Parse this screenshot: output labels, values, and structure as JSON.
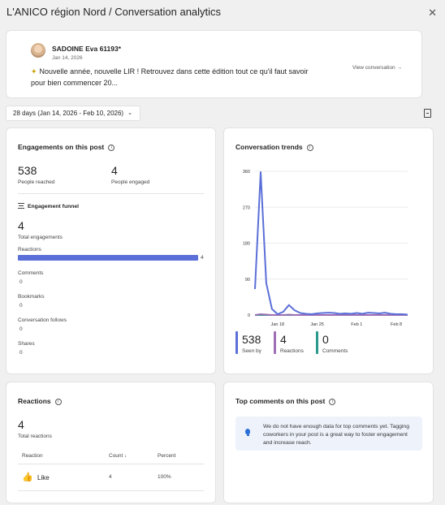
{
  "header": {
    "title": "L'ANICO région Nord / Conversation analytics",
    "close_label": "✕"
  },
  "post": {
    "author": "SADOINE Eva 61193*",
    "date": "Jan 14, 2026",
    "text_line1": "Nouvelle année, nouvelle LIR ! Retrouvez dans cette édition tout ce qu'il faut savoir",
    "text_line2": "pour bien commencer 20...",
    "view_label": "View conversation →"
  },
  "filter": {
    "date_range": "28 days (Jan 14, 2026 - Feb 10, 2026)"
  },
  "engagements": {
    "title": "Engagements on this post",
    "reached_value": "538",
    "reached_label": "People reached",
    "engaged_value": "4",
    "engaged_label": "People engaged",
    "funnel_title": "Engagement funnel",
    "total_value": "4",
    "total_label": "Total engagements",
    "funnel": [
      {
        "label": "Reactions",
        "value": "4",
        "fraction": 1.0
      },
      {
        "label": "Comments",
        "value": "0"
      },
      {
        "label": "Bookmarks",
        "value": "0"
      },
      {
        "label": "Conversation follows",
        "value": "0"
      },
      {
        "label": "Shares",
        "value": "0"
      }
    ]
  },
  "trends": {
    "title": "Conversation trends",
    "legend": [
      {
        "value": "538",
        "label": "Seen by",
        "color": "#5b6fd8"
      },
      {
        "value": "4",
        "label": "Reactions",
        "color": "#9d6fb5"
      },
      {
        "value": "0",
        "label": "Comments",
        "color": "#2a9a8a"
      }
    ]
  },
  "chart_data": {
    "type": "line",
    "title": "Conversation trends",
    "x": [
      "Jan 14",
      "Jan 15",
      "Jan 16",
      "Jan 17",
      "Jan 18",
      "Jan 19",
      "Jan 20",
      "Jan 21",
      "Jan 22",
      "Jan 23",
      "Jan 24",
      "Jan 25",
      "Jan 26",
      "Jan 27",
      "Jan 28",
      "Jan 29",
      "Jan 30",
      "Jan 31",
      "Feb 1",
      "Feb 2",
      "Feb 3",
      "Feb 4",
      "Feb 5",
      "Feb 6",
      "Feb 7",
      "Feb 8",
      "Feb 9",
      "Feb 10"
    ],
    "x_tick_labels": [
      "Jan 18",
      "Jan 25",
      "Feb 1",
      "Feb 8"
    ],
    "y_ticks": [
      "360",
      "270",
      "180",
      "90",
      "0"
    ],
    "ylim": [
      0,
      360
    ],
    "series": [
      {
        "name": "Seen by",
        "color": "#5b6fd8",
        "values": [
          65,
          358,
          80,
          15,
          2,
          8,
          25,
          12,
          5,
          3,
          2,
          4,
          5,
          6,
          5,
          3,
          4,
          3,
          5,
          3,
          6,
          5,
          4,
          6,
          3,
          2,
          2,
          1
        ]
      },
      {
        "name": "Reactions",
        "color": "#9d6fb5",
        "values": [
          0,
          2,
          1,
          0,
          0,
          0,
          1,
          0,
          0,
          0,
          0,
          0,
          0,
          0,
          0,
          0,
          0,
          0,
          0,
          0,
          0,
          0,
          0,
          0,
          0,
          0,
          0,
          0
        ]
      },
      {
        "name": "Comments",
        "color": "#2a9a8a",
        "values": [
          0,
          0,
          0,
          0,
          0,
          0,
          0,
          0,
          0,
          0,
          0,
          0,
          0,
          0,
          0,
          0,
          0,
          0,
          0,
          0,
          0,
          0,
          0,
          0,
          0,
          0,
          0,
          0
        ]
      }
    ]
  },
  "reactions": {
    "title": "Reactions",
    "total_value": "4",
    "total_label": "Total reactions",
    "col_reaction": "Reaction",
    "col_count": "Count ↓",
    "col_percent": "Percent",
    "rows": [
      {
        "icon": "thumbs-up-icon",
        "label": "Like",
        "count": "4",
        "percent": "100%"
      }
    ]
  },
  "top_comments": {
    "title": "Top comments on this post",
    "message": "We do not have enough data for top comments yet. Tagging coworkers in your post is a great way to foster engagement and increase reach."
  }
}
